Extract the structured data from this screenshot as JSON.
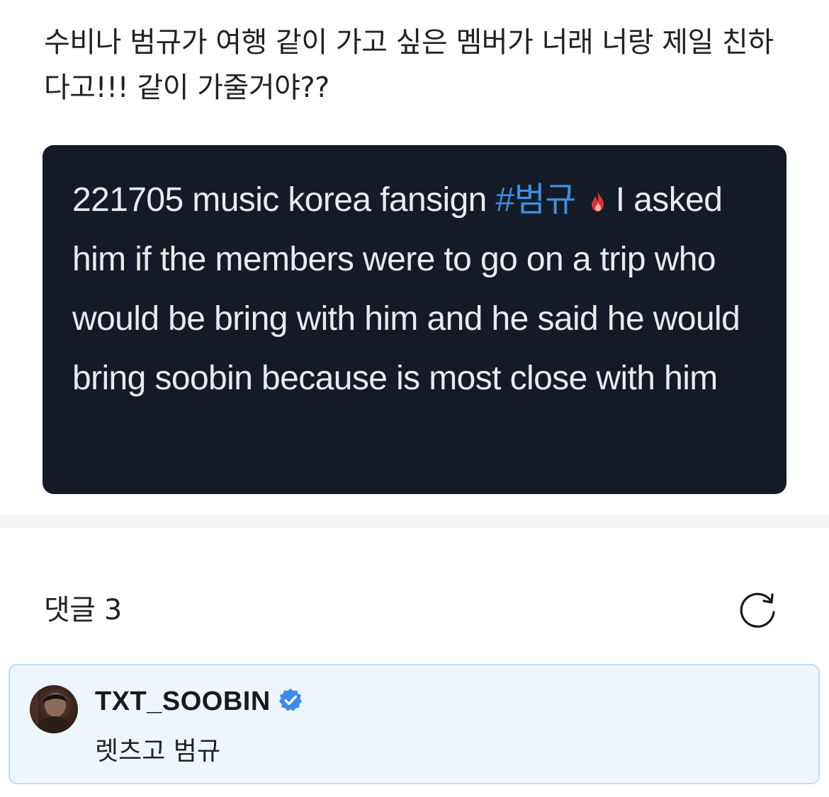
{
  "post": {
    "text": "수비나 범규가 여행 같이 가고 싶은 멤버가 너래 너랑 제일 친하다고!!! 같이 가줄거야??"
  },
  "embed": {
    "prefix": "221705 music korea fansign ",
    "hashtag": "#범규",
    "after_icon": "I asked him if the members were to go on a trip who would be bring with him and he said he would bring soobin because is most close with him",
    "icon": "fire-icon",
    "colors": {
      "background": "#151b26",
      "hashtag": "#3d8fe6",
      "text": "#e9ebee"
    }
  },
  "comments": {
    "header": "댓글 3",
    "refresh_icon": "refresh-icon",
    "items": [
      {
        "author": "TXT_SOOBIN",
        "verified_icon": "verified-badge-icon",
        "text": "렛츠고 범규"
      }
    ]
  },
  "colors": {
    "card_background": "#edf6fd",
    "card_border": "#bfdcf2",
    "verified": "#3b8beb"
  }
}
